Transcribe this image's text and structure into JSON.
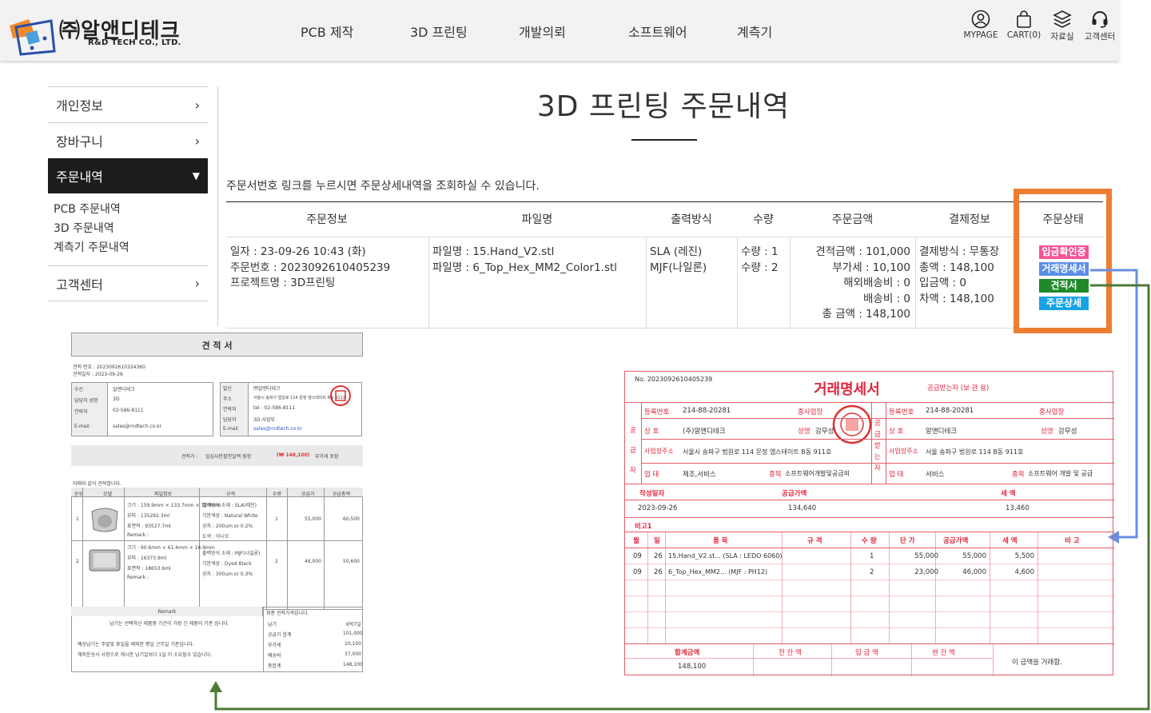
{
  "brand": {
    "name_ko": "㈜알앤디테크",
    "name_en": "R&D TECH CO., LTD."
  },
  "nav": [
    "PCB 제작",
    "3D 프린팅",
    "개발의뢰",
    "소프트웨어",
    "계측기"
  ],
  "util": [
    {
      "label": "MYPAGE",
      "icon": "user-icon"
    },
    {
      "label": "CART(0)",
      "icon": "cart-icon"
    },
    {
      "label": "자료실",
      "icon": "layers-icon"
    },
    {
      "label": "고객센터",
      "icon": "headset-icon"
    }
  ],
  "sidebar": {
    "items": [
      "개인정보",
      "장바구니",
      "주문내역"
    ],
    "sub": [
      "PCB 주문내역",
      "3D 주문내역",
      "계측기 주문내역"
    ],
    "support": "고객센터"
  },
  "page": {
    "title": "3D 프린팅 주문내역",
    "notice": "주문서번호 링크를 누르시면 주문상세내역을 조회하실 수 있습니다."
  },
  "table": {
    "headers": [
      "주문정보",
      "파일명",
      "출력방식",
      "수량",
      "주문금액",
      "결제정보",
      "주문상태"
    ],
    "row": {
      "info": [
        "일자 : 23-09-26 10:43 (화)",
        "주문번호 : 2023092610405239",
        "프로젝트명 : 3D프린팅"
      ],
      "files": [
        "파일명 : 15.Hand_V2.stl",
        "파일명 : 6_Top_Hex_MM2_Color1.stl"
      ],
      "methods": [
        "SLA (레진)",
        "MJF(나일론)"
      ],
      "qty": [
        "수량 : 1",
        "수량 : 2"
      ],
      "amount": [
        "견적금액 : 101,000",
        "부가세 : 10,100",
        "해외배송비 : 0",
        "배송비 : 0",
        "총 금액 : 148,100"
      ],
      "payment": [
        "결제방식 : 무통장",
        "총액 : 148,100",
        "입금액 : 0",
        "차액 : 148,100"
      ],
      "status_buttons": [
        {
          "label": "입금확인중",
          "color": "#f25595"
        },
        {
          "label": "거래명세서",
          "color": "#5b8ee6"
        },
        {
          "label": "견적서",
          "color": "#1f8a2a"
        },
        {
          "label": "주문상세",
          "color": "#17a2e8"
        }
      ]
    }
  },
  "colors": {
    "highlight": "#ed7d31",
    "arrow_blue": "#6a8fe0",
    "arrow_green": "#4e7a34",
    "invoice_red": "#e45c6a"
  },
  "quote": {
    "title": "견 적 서",
    "meta": [
      "견적 번호 : 2023092610324360",
      "견적일자 : 2023-09-26"
    ],
    "left_rows": [
      [
        "수신",
        "알앤디테크"
      ],
      [
        "담당자 성명",
        "3D"
      ],
      [
        "연락처",
        "02-586-8111"
      ],
      [
        "E-mail",
        "sales@rndtech.co.kr"
      ]
    ],
    "right_rows": [
      [
        "발신",
        "㈜알앤디테크"
      ],
      [
        "주소",
        "서울시 송파구 법원로 114 문정 엠스테이트 B동 911호"
      ],
      [
        "연락처",
        "tel : 02-586-8111"
      ],
      [
        "담당자",
        "3D 사업부"
      ],
      [
        "E-mail",
        "sales@rndtech.co.kr"
      ]
    ],
    "total_line": [
      "견적가 :",
      "일십사만팔천일백 원정",
      "(₩ 148,100)",
      "부가세 포함"
    ],
    "intro": "아래와 같이 견적합니다.",
    "item_headers": [
      "순위",
      "모델",
      "파일정보",
      "규격",
      "수량",
      "공급가",
      "공급총액"
    ],
    "items": [
      {
        "no": "1",
        "info": [
          "크기 : 159.9mm × 133.7mm × 73.9mm",
          "부피 : 135292.3ml",
          "표면적 : 93527.7ml",
          "Remark :"
        ],
        "spec": [
          "출력방식 소재 : SLA(레진)",
          "기본색상 : Natural White",
          "공차 : 200um or 0.2%",
          "도색 : 아니오"
        ],
        "qty": "1",
        "price": "55,000",
        "total": "60,500"
      },
      {
        "no": "2",
        "info": [
          "크기 : 90.6mm × 61.4mm × 16.9mm",
          "부피 : 16373.9ml",
          "표면적 : 18653.6ml",
          "Remark :"
        ],
        "spec": [
          "출력방식 소재 : MJF(나일론)",
          "기본색상 : Dyed Black",
          "공차 : 300um or 0.3%"
        ],
        "qty": "2",
        "price": "46,000",
        "total": "50,600"
      }
    ],
    "remark": "Remark",
    "remark_text": [
      "납기는 선택하신 제품중 기간이 가장 긴 제품이 기준 입니다.",
      "예상납기는 주말및 휴일을 제외한 평일 근무일 기준입니다.",
      "해외운송사 사정으로 게시한 납기일보다 1일 이 소요될수 있습니다."
    ],
    "summary_head": "최종 견적가격입니다.",
    "summary": [
      [
        "납기",
        "6박7일"
      ],
      [
        "공급가 합계",
        "101,000"
      ],
      [
        "부가세",
        "10,100"
      ],
      [
        "배송비",
        "37,000"
      ],
      [
        "총합계",
        "148,100"
      ]
    ]
  },
  "invoice": {
    "no": "No. 2023092610405239",
    "title": "거래명세서",
    "subtitle": "공급받는자 (보 관 용)",
    "supplier_side": "공급자",
    "receiver_side": "공급받는자",
    "supplier": {
      "reg_label": "등록번호",
      "reg": "214-88-20281",
      "branch": "종사업장",
      "name_label": "상 호",
      "name": "(주)알앤디테크",
      "ceo_label": "성명",
      "ceo": "강무성",
      "addr_label": "사업장주소",
      "addr": "서울시 송파구 법원로 114 문정 엠스테이트 B동 911호",
      "type_label": "업 태",
      "type": "제조,서비스",
      "item_label": "종목",
      "item": "소프트웨어개발및공급외"
    },
    "receiver": {
      "reg": "214-88-20281",
      "name": "알앤디테크",
      "ceo": "강무성",
      "addr": "서울 송파구 법원로 114 B동 911호",
      "type": "서비스",
      "item": "소프트웨어 개발 및 공급"
    },
    "date_head": "작성일자",
    "supply_head": "공급가액",
    "tax_head": "세 액",
    "date": "2023-09-26",
    "supply": "134,640",
    "tax": "13,460",
    "memo": "비고1",
    "line_headers": [
      "월",
      "일",
      "품 목",
      "규 격",
      "수 량",
      "단 가",
      "공급가액",
      "세 액",
      "비 고"
    ],
    "lines": [
      [
        "09",
        "26",
        "15.Hand_V2.st... (SLA : LEDO 6060)",
        "",
        "1",
        "55,000",
        "55,000",
        "5,500",
        ""
      ],
      [
        "09",
        "26",
        "6_Top_Hex_MM2... (MJF : PH12)",
        "",
        "2",
        "23,000",
        "46,000",
        "4,600",
        ""
      ]
    ],
    "foot_headers": [
      "합계금액",
      "전 잔 액",
      "입 금 액",
      "현 잔 액"
    ],
    "foot_total": "148,100",
    "foot_note": "이 금액을 거래함."
  }
}
